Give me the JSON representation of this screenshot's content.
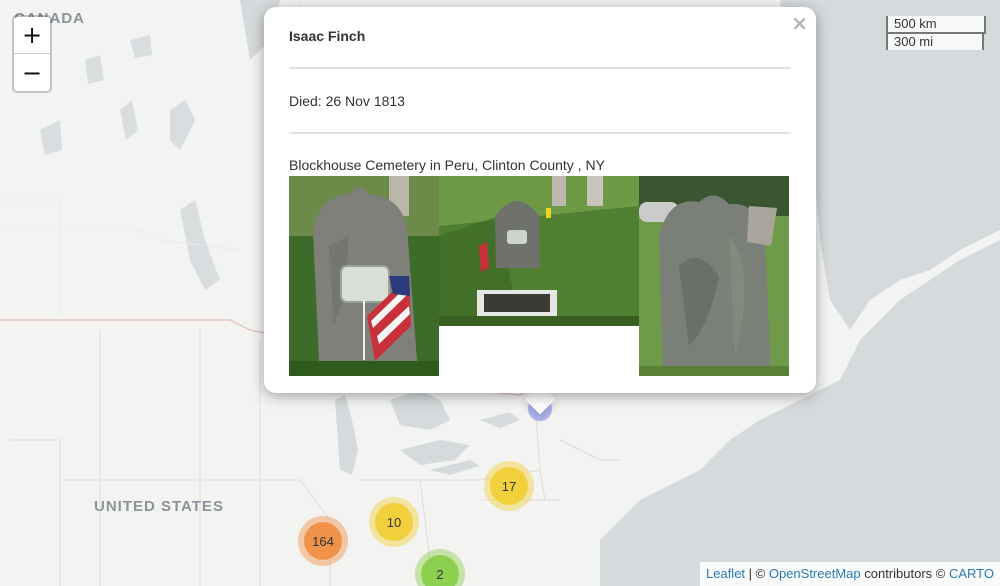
{
  "map": {
    "country_labels": {
      "canada": "CANADA",
      "usa": "UNITED STATES"
    }
  },
  "zoom": {
    "in_label": "+",
    "out_label": "−"
  },
  "scale": {
    "km": "500 km",
    "mi": "300 mi"
  },
  "popup": {
    "name": "Isaac Finch",
    "died": "Died: 26 Nov 1813",
    "cemetery": "Blockhouse Cemetery in Peru, Clinton County , NY",
    "close": "×",
    "photos": [
      "gravestone-photo-with-flag",
      "gravestone-photo-with-plaque",
      "weathered-gravestone-photo"
    ]
  },
  "clusters": [
    {
      "count": "17",
      "color": "#f1d03c"
    },
    {
      "count": "10",
      "color": "#f1d03c"
    },
    {
      "count": "164",
      "color": "#f0924a"
    },
    {
      "count": "2",
      "color": "#8dcf4f"
    }
  ],
  "attribution": {
    "leaflet": "Leaflet",
    "sep1": " | © ",
    "osm": "OpenStreetMap",
    "contrib": " contributors © ",
    "carto": "CARTO"
  },
  "colors": {
    "water": "#d5dadc",
    "land": "#f3f3f1",
    "border": "#e4c9c9",
    "accent_link": "#2a7ab0"
  }
}
